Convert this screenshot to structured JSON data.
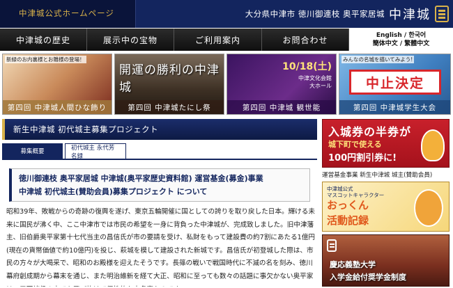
{
  "header": {
    "official_label": "中津城公式ホームページ",
    "location": "大分県中津市 徳川御連枝 奥平家居城",
    "logo_text": "中津城"
  },
  "nav": {
    "items": [
      "中津城の歴史",
      "展示中の宝物",
      "ご利用案内",
      "お問合わせ"
    ],
    "lang_line1": "English / 한국어",
    "lang_line2": "簡体中文 / 繁體中文"
  },
  "banners": [
    {
      "sub": "新緑のお内裏様とお雛様の登場！",
      "caption": "第四回 中津城人間ひな飾り"
    },
    {
      "big": "開運の勝利の中津城",
      "caption": "第四回 中津城たにし祭"
    },
    {
      "date": "10/18(土)",
      "venue1": "中津文化会館",
      "venue2": "大ホール",
      "caption": "第四回 中津城 観世能"
    },
    {
      "sub": "みんなの名城を描いてみよう!",
      "cancel": "中止決定",
      "caption": "第四回 中津城学生大会"
    }
  ],
  "project": {
    "heading": "新生中津城 初代城主募集プロジェクト",
    "tabs": [
      "募集概要",
      "初代城主 永代芳名録"
    ],
    "title_line1": "徳川御連枝 奥平家居城 中津城(奥平家歴史資料館) 運営基金(募金)事業",
    "title_line2": "中津城 初代城主(賛助会員)募集プロジェクト について",
    "body": "昭和39年、敗戦からの奇跡の復興を遂げ、東京五輪開催に国としての誇りを取り戻した日本。輝ける未来に国民が沸く中、ここ中津市では市民の希望を一身に背負った中津城が、完成致しました。旧中津藩主、旧伯爵奥平家第十七代当主の昌信氏が市の要請を受け、私財をもって建設費の約7割にあたる1億円(現在の貨幣価値で約10億円)を投じ、萩城を模して建設された新城です。昌信氏が初登城した際は、市民の方々が大喝采で、昭和のお殿様を迎えたそうです。長篠の戦いで戦国時代に不滅の名を刻み、徳川幕府創成期から幕末を通じ、また明治維新を経て大正、昭和に至っても数々の話題に事欠かない奥平家は、三百諸侯の中でも飛び抜けて個性的な大名家なのです。"
  },
  "sidebar": {
    "ad1": {
      "line1": "入城券の半券が",
      "line2": "城下町で使える",
      "line3": "100円割引券に!"
    },
    "caption": "運営基金事業 新生中津城 城主(賛助会員)",
    "ad2": {
      "small1": "中津城公式",
      "small2": "マスコットキャラクター",
      "line1": "おっくん",
      "line2": "活動記録"
    },
    "ad3": {
      "line1": "慶応義塾大学",
      "line2": "入学金給付奨学金制度"
    }
  }
}
